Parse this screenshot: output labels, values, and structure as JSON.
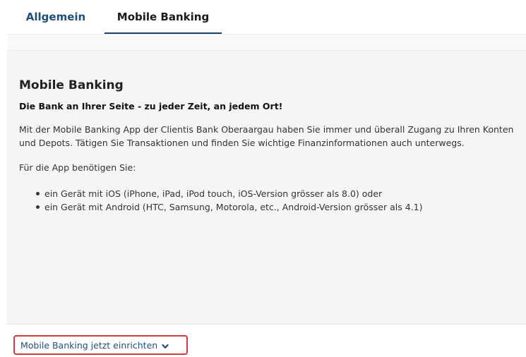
{
  "tabs": [
    {
      "label": "Allgemein",
      "active": false
    },
    {
      "label": "Mobile Banking",
      "active": true
    }
  ],
  "content": {
    "heading": "Mobile Banking",
    "subheading": "Die Bank an Ihrer Seite - zu jeder Zeit, an jedem Ort!",
    "paragraph": "Mit der Mobile Banking App der Clientis Bank Oberaargau haben Sie immer und überall Zugang zu Ihren Konten und Depots. Tätigen Sie Transaktionen und finden Sie wichtige Finanzinformationen auch unterwegs.",
    "requirements_intro": "Für die App benötigen Sie:",
    "requirements": [
      "ein Gerät mit iOS (iPhone, iPad, iPod touch, iOS-Version grösser als 8.0) oder",
      "ein Gerät mit Android (HTC, Samsung, Motorola, etc., Android-Version grösser als 4.1)"
    ]
  },
  "footer": {
    "setup_link_label": "Mobile Banking jetzt einrichten",
    "setup_link_icon": "chevron-down-icon"
  },
  "colors": {
    "link_blue": "#1f4f7a",
    "highlight_red": "#d23a3a",
    "panel_bg": "#f5f5f5"
  }
}
